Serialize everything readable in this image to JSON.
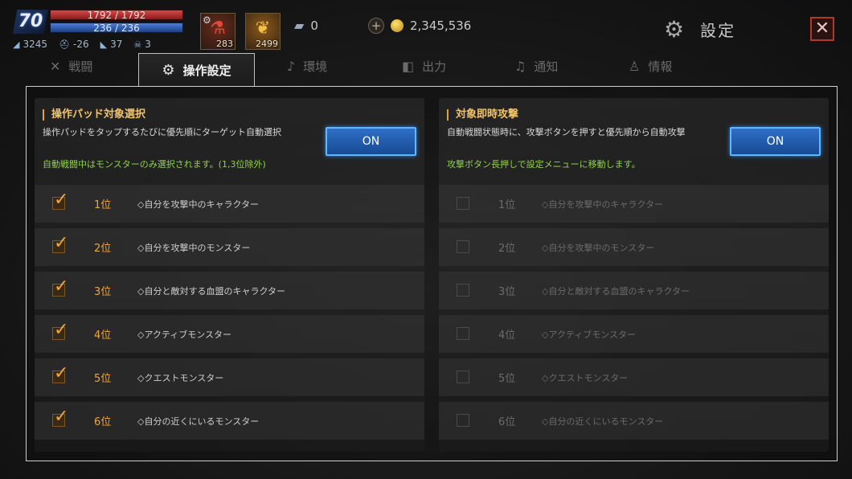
{
  "hud": {
    "level": "70",
    "hp": "1792 / 1792",
    "mp": "236 / 236",
    "stats": [
      {
        "icon": "wing-icon",
        "value": "3245"
      },
      {
        "icon": "helmet-icon",
        "value": "-26"
      },
      {
        "icon": "boot-icon",
        "value": "37"
      },
      {
        "icon": "skull-icon",
        "value": "3"
      }
    ],
    "items": [
      {
        "icon": "red-potion-icon",
        "count": "283"
      },
      {
        "icon": "feather-icon",
        "count": "2499"
      }
    ],
    "silver": "0",
    "gold": "2,345,536",
    "settings_label": "設定",
    "close_label": "✕"
  },
  "tabs": [
    {
      "label": "戦闘",
      "icon": "swords-icon"
    },
    {
      "label": "操作設定",
      "icon": "gear-icon",
      "active": true
    },
    {
      "label": "環境",
      "icon": "music-note-icon"
    },
    {
      "label": "出力",
      "icon": "speaker-icon"
    },
    {
      "label": "通知",
      "icon": "bell-icon"
    },
    {
      "label": "情報",
      "icon": "person-icon"
    }
  ],
  "left_panel": {
    "title": "操作パッド対象選択",
    "desc": "操作パッドをタップするたびに優先順にターゲット自動選択",
    "note": "自動戦闘中はモンスターのみ選択されます。(1,3位除外)",
    "button": "ON",
    "rows": [
      {
        "rank": "1位",
        "text": "◇自分を攻撃中のキャラクター",
        "checked": true
      },
      {
        "rank": "2位",
        "text": "◇自分を攻撃中のモンスター",
        "checked": true
      },
      {
        "rank": "3位",
        "text": "◇自分と敵対する血盟のキャラクター",
        "checked": true
      },
      {
        "rank": "4位",
        "text": "◇アクティブモンスター",
        "checked": true
      },
      {
        "rank": "5位",
        "text": "◇クエストモンスター",
        "checked": true
      },
      {
        "rank": "6位",
        "text": "◇自分の近くにいるモンスター",
        "checked": true
      }
    ]
  },
  "right_panel": {
    "title": "対象即時攻撃",
    "desc": "自動戦闘状態時に、攻撃ボタンを押すと優先順から自動攻撃",
    "note": "攻撃ボタン長押しで設定メニューに移動します。",
    "button": "ON",
    "rows": [
      {
        "rank": "1位",
        "text": "◇自分を攻撃中のキャラクター",
        "checked": false
      },
      {
        "rank": "2位",
        "text": "◇自分を攻撃中のモンスター",
        "checked": false
      },
      {
        "rank": "3位",
        "text": "◇自分と敵対する血盟のキャラクター",
        "checked": false
      },
      {
        "rank": "4位",
        "text": "◇アクティブモンスター",
        "checked": false
      },
      {
        "rank": "5位",
        "text": "◇クエストモンスター",
        "checked": false
      },
      {
        "rank": "6位",
        "text": "◇自分の近くにいるモンスター",
        "checked": false
      }
    ]
  },
  "colors": {
    "accent": "#f0a63b",
    "button": "#2f6fc7",
    "note": "#8fd24a"
  }
}
